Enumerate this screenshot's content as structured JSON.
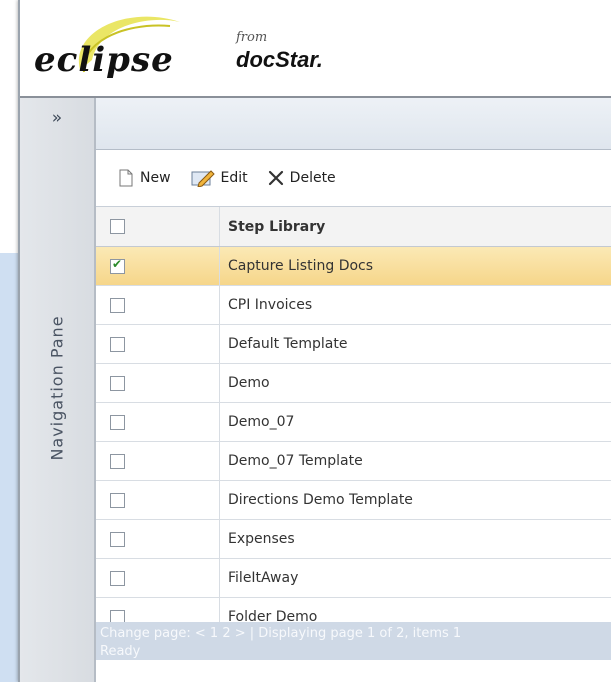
{
  "brand": {
    "logo_main": "eclipse",
    "logo_from": "from",
    "logo_company": "docStar."
  },
  "nav": {
    "toggle_glyph": "»",
    "pane_label": "Navigation Pane"
  },
  "toolbar": {
    "new_label": "New",
    "edit_label": "Edit",
    "delete_label": "Delete"
  },
  "grid": {
    "column_header": "Step Library",
    "rows": [
      {
        "name": "Capture Listing Docs",
        "checked": true
      },
      {
        "name": "CPI Invoices",
        "checked": false
      },
      {
        "name": "Default Template",
        "checked": false
      },
      {
        "name": "Demo",
        "checked": false
      },
      {
        "name": "Demo_07",
        "checked": false
      },
      {
        "name": "Demo_07 Template",
        "checked": false
      },
      {
        "name": "Directions Demo Template",
        "checked": false
      },
      {
        "name": "Expenses",
        "checked": false
      },
      {
        "name": "FileItAway",
        "checked": false
      },
      {
        "name": "Folder Demo",
        "checked": false
      }
    ]
  },
  "footer": {
    "pager_text": "Change page: < 1 2 > | Displaying page 1 of 2, items 1",
    "status_text": "Ready"
  },
  "colors": {
    "selected_row": "#f6d68a",
    "swoosh": "#e6e24a",
    "footer_bg": "#cfd9e6"
  }
}
